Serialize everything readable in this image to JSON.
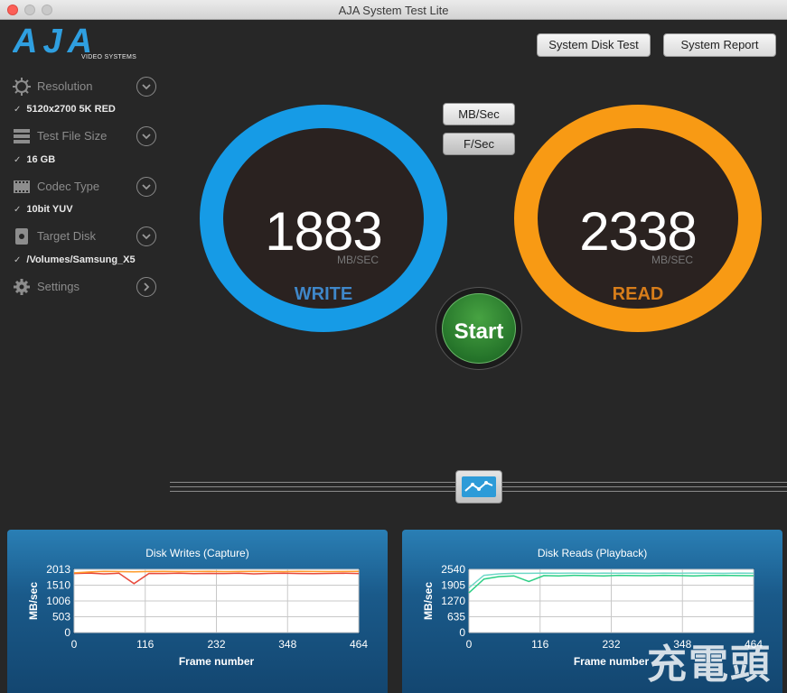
{
  "window": {
    "title": "AJA System Test Lite"
  },
  "logo": {
    "text": "AJA",
    "subtitle": "VIDEO SYSTEMS"
  },
  "toolbar": {
    "system_disk_test": "System Disk Test",
    "system_report": "System Report"
  },
  "settings": [
    {
      "label": "Resolution",
      "value": "5120x2700 5K RED",
      "icon": "resolution-icon"
    },
    {
      "label": "Test File Size",
      "value": "16 GB",
      "icon": "file-size-icon"
    },
    {
      "label": "Codec Type",
      "value": "10bit YUV",
      "icon": "codec-icon"
    },
    {
      "label": "Target Disk",
      "value": "/Volumes/Samsung_X5",
      "icon": "disk-icon"
    },
    {
      "label": "Settings",
      "value": "",
      "icon": "gear-icon"
    }
  ],
  "units": {
    "mb_sec": "MB/Sec",
    "f_sec": "F/Sec",
    "selected": "F/Sec"
  },
  "write": {
    "value": "1883",
    "unit": "MB/SEC",
    "label": "WRITE",
    "color": "#169be6"
  },
  "read": {
    "value": "2338",
    "unit": "MB/SEC",
    "label": "READ",
    "color": "#f89a14"
  },
  "start": {
    "label": "Start"
  },
  "watermark": {
    "text": "充電頭",
    "url": "www.chongdiantou.com"
  },
  "chart_data": [
    {
      "type": "line",
      "title": "Disk Writes (Capture)",
      "xlabel": "Frame number",
      "ylabel": "MB/sec",
      "xlim": [
        0,
        464
      ],
      "ylim": [
        0,
        2013
      ],
      "x_ticks": [
        "0",
        "116",
        "232",
        "348",
        "464"
      ],
      "y_ticks": [
        "0",
        "503",
        "1006",
        "1510",
        "2013"
      ],
      "series": [
        {
          "color": "#e84a3c",
          "values": [
            1880,
            1895,
            1870,
            1890,
            1560,
            1885,
            1880,
            1890,
            1875,
            1885,
            1880,
            1890,
            1870,
            1885,
            1890,
            1880,
            1875,
            1885,
            1890,
            1880
          ]
        },
        {
          "color": "#ff9a2a",
          "values": [
            1900,
            1930,
            1950,
            1940,
            1935,
            1945,
            1950,
            1940,
            1945,
            1950,
            1940,
            1945,
            1950,
            1945,
            1940,
            1950,
            1945,
            1940,
            1945,
            1950
          ]
        }
      ]
    },
    {
      "type": "line",
      "title": "Disk Reads (Playback)",
      "xlabel": "Frame number",
      "ylabel": "MB/sec",
      "xlim": [
        0,
        464
      ],
      "ylim": [
        0,
        2540
      ],
      "x_ticks": [
        "0",
        "116",
        "232",
        "348",
        "464"
      ],
      "y_ticks": [
        "0",
        "635",
        "1270",
        "1905",
        "2540"
      ],
      "series": [
        {
          "color": "#2ccf85",
          "values": [
            1600,
            2150,
            2250,
            2280,
            2050,
            2290,
            2280,
            2300,
            2290,
            2280,
            2300,
            2290,
            2285,
            2300,
            2290,
            2280,
            2295,
            2300,
            2290,
            2285
          ]
        },
        {
          "color": "#6fd8c8",
          "values": [
            1800,
            2300,
            2360,
            2380,
            2380,
            2390,
            2385,
            2390,
            2380,
            2390,
            2385,
            2390,
            2380,
            2390,
            2385,
            2390,
            2385,
            2380,
            2390,
            2385
          ]
        }
      ]
    }
  ]
}
